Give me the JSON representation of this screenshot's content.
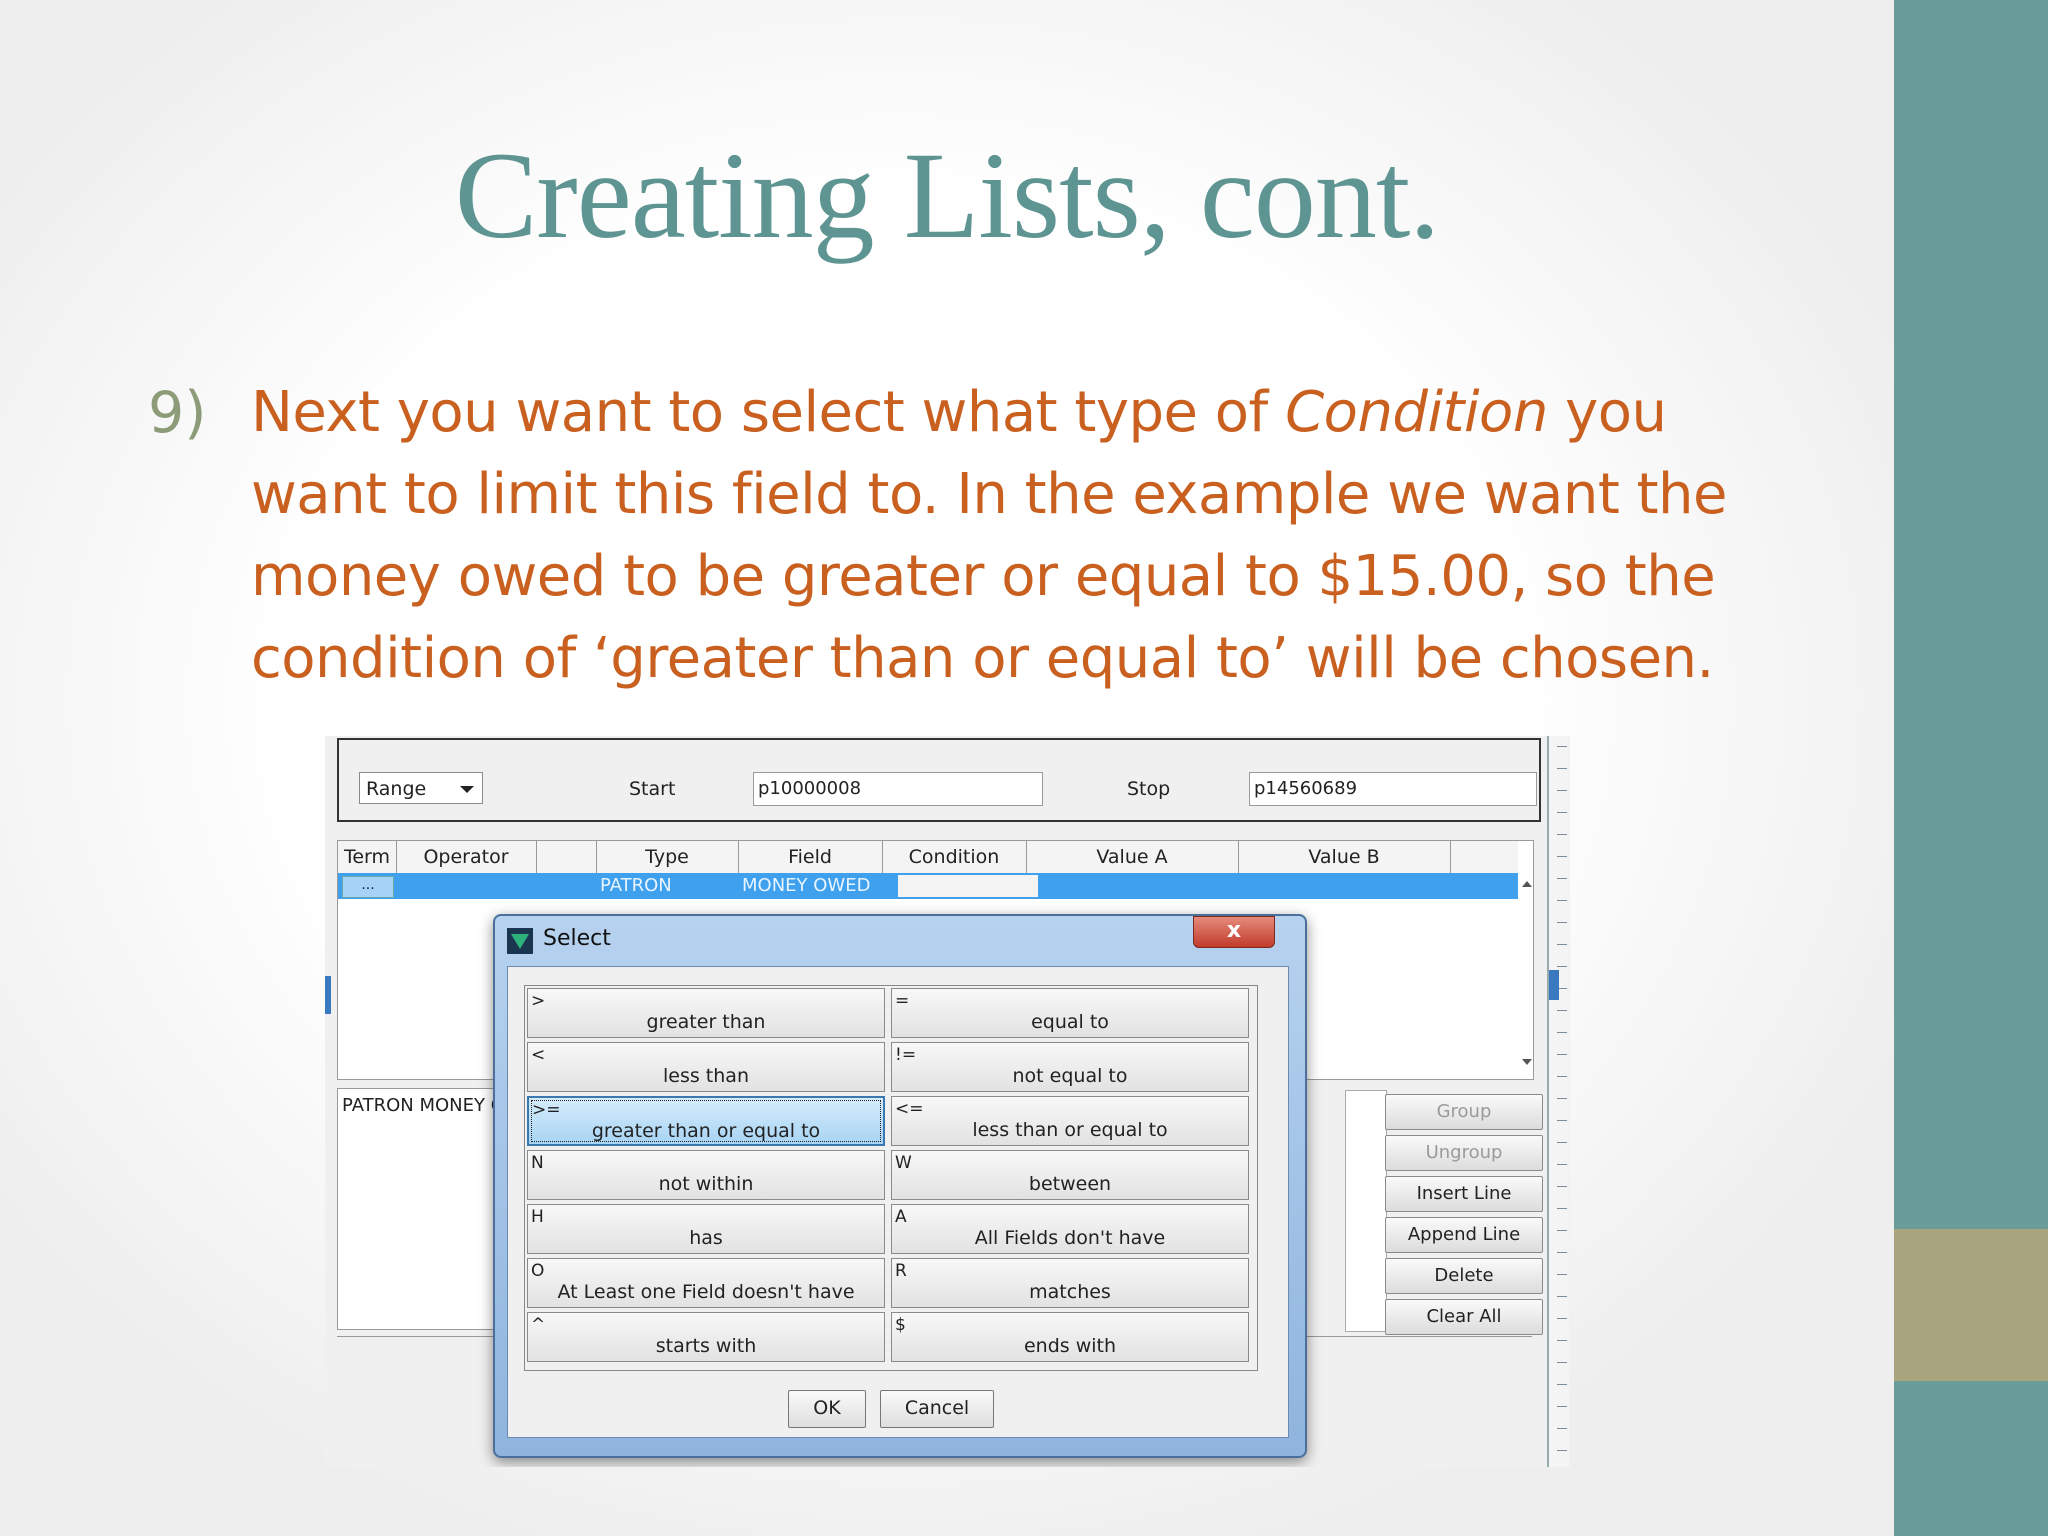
{
  "slide": {
    "title": "Creating Lists, cont.",
    "bullet_number": "9)",
    "text_before_italic": "Next you want to select what type of ",
    "italic_word": "Condition",
    "text_after_italic": " you want to limit this field to. In the example we want the money owed to be greater or equal to $15.00, so the condition of ‘greater than or equal to’ will be chosen."
  },
  "range_panel": {
    "dropdown_value": "Range",
    "start_label": "Start",
    "start_value": "p10000008",
    "stop_label": "Stop",
    "stop_value": "p14560689"
  },
  "grid": {
    "headers": [
      "Term",
      "Operator",
      "",
      "Type",
      "Field",
      "Condition",
      "Value A",
      "Value B"
    ],
    "row": {
      "term_button": "...",
      "type": "PATRON",
      "field": "MONEY OWED"
    }
  },
  "left_panel": {
    "text": "PATRON  MONEY OWED"
  },
  "side_buttons": [
    {
      "label": "Group",
      "enabled": false
    },
    {
      "label": "Ungroup",
      "enabled": false
    },
    {
      "label": "Insert Line",
      "enabled": true
    },
    {
      "label": "Append Line",
      "enabled": true
    },
    {
      "label": "Delete",
      "enabled": true
    },
    {
      "label": "Clear All",
      "enabled": true
    }
  ],
  "dialog": {
    "title": "Select",
    "close": "x",
    "conditions": [
      {
        "symbol": ">",
        "label": "greater than"
      },
      {
        "symbol": "=",
        "label": "equal to"
      },
      {
        "symbol": "<",
        "label": "less than"
      },
      {
        "symbol": "!=",
        "label": "not equal to"
      },
      {
        "symbol": ">=",
        "label": "greater than or equal to"
      },
      {
        "symbol": "<=",
        "label": "less than or equal to"
      },
      {
        "symbol": "N",
        "label": "not within"
      },
      {
        "symbol": "W",
        "label": "between"
      },
      {
        "symbol": "H",
        "label": "has"
      },
      {
        "symbol": "A",
        "label": "All Fields don't have"
      },
      {
        "symbol": "O",
        "label": "At Least one Field doesn't have"
      },
      {
        "symbol": "R",
        "label": "matches"
      },
      {
        "symbol": "^",
        "label": "starts with"
      },
      {
        "symbol": "$",
        "label": "ends with"
      }
    ],
    "selected_symbol": ">=",
    "ok_label": "OK",
    "cancel_label": "Cancel"
  },
  "colors": {
    "title": "#5e9592",
    "body_text": "#c9601f",
    "bullet_number": "#8c9b78",
    "side_bar": "#6a9d99",
    "side_accent": "#a8a47d",
    "row_selected": "#3fa0ee"
  }
}
